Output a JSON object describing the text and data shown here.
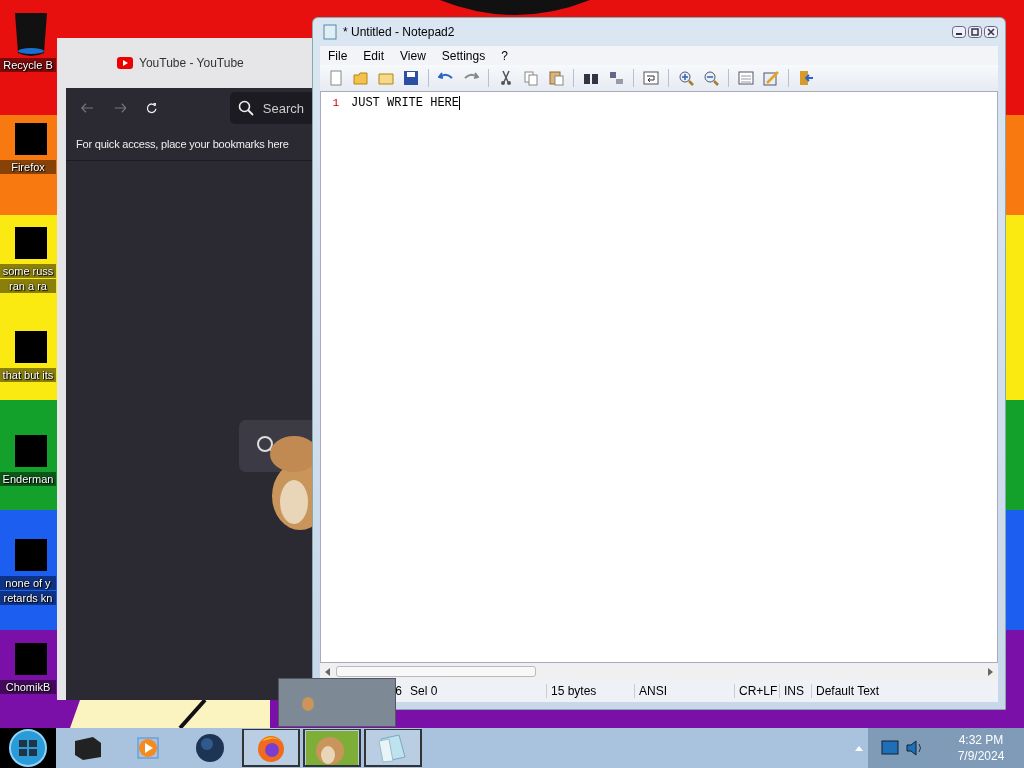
{
  "desktop_icons": [
    {
      "kind": "trash",
      "lines": [
        "Recycle B"
      ]
    },
    {
      "kind": "redacted",
      "lines": [
        "Firefox"
      ]
    },
    {
      "kind": "redacted",
      "lines": [
        "some russ",
        "ran a ra"
      ]
    },
    {
      "kind": "redacted",
      "lines": [
        "that but its"
      ]
    },
    {
      "kind": "redacted",
      "lines": [
        "Enderman"
      ]
    },
    {
      "kind": "redacted",
      "lines": [
        "none of y",
        "retards kn"
      ]
    },
    {
      "kind": "redacted",
      "lines": [
        "ChomikB"
      ]
    }
  ],
  "browser": {
    "tab_title": "YouTube - YouTube",
    "search_placeholder": "Search",
    "bookmarks_hint": "For quick access, place your bookmarks here"
  },
  "notepad": {
    "title": "* Untitled - Notepad2",
    "menu": [
      "File",
      "Edit",
      "View",
      "Settings",
      "?"
    ],
    "lines": [
      {
        "number": "1",
        "text": "JUST WRITE HERE"
      }
    ],
    "status": [
      "6",
      "Sel 0",
      "15 bytes",
      "ANSI",
      "CR+LF",
      "INS",
      "Default Text"
    ]
  },
  "taskbar": {
    "buttons": [
      {
        "kind": "box",
        "running": false
      },
      {
        "kind": "player",
        "running": false
      },
      {
        "kind": "globe",
        "running": false
      },
      {
        "kind": "firefox",
        "running": true
      },
      {
        "kind": "hamster",
        "running": true
      },
      {
        "kind": "notepad",
        "running": true
      }
    ],
    "clock_time": "4:32 PM",
    "clock_date": "7/9/2024"
  }
}
